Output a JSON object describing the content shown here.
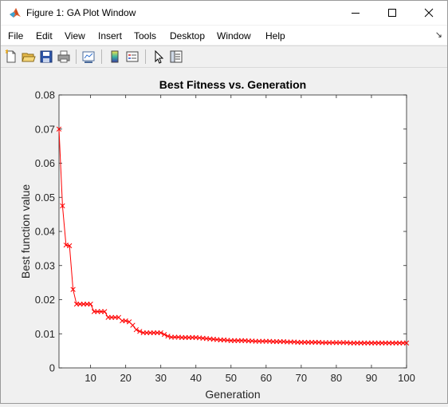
{
  "window": {
    "title": "Figure 1: GA Plot Window"
  },
  "menu": {
    "items": [
      "File",
      "Edit",
      "View",
      "Insert",
      "Tools",
      "Desktop",
      "Window",
      "Help"
    ]
  },
  "toolbar": {
    "buttons": [
      "new-figure-icon",
      "open-file-icon",
      "save-icon",
      "print-icon",
      "link-plot-icon",
      "insert-colorbar-icon",
      "insert-legend-icon",
      "edit-plot-arrow-icon",
      "property-inspector-icon"
    ]
  },
  "chart_data": {
    "type": "line",
    "title": "Best Fitness vs. Generation",
    "xlabel": "Generation",
    "ylabel": "Best function value",
    "xlim": [
      1,
      100
    ],
    "ylim": [
      0,
      0.08
    ],
    "xticks": [
      "10",
      "20",
      "30",
      "40",
      "50",
      "60",
      "70",
      "80",
      "90",
      "100"
    ],
    "yticks": [
      "0",
      "0.01",
      "0.02",
      "0.03",
      "0.04",
      "0.05",
      "0.06",
      "0.07",
      "0.08"
    ],
    "grid": false,
    "series": [
      {
        "color": "#ff0000",
        "marker": "x",
        "x": [
          1,
          2,
          3,
          4,
          5,
          6,
          7,
          8,
          9,
          10,
          11,
          12,
          13,
          14,
          15,
          16,
          17,
          18,
          19,
          20,
          21,
          22,
          23,
          24,
          25,
          26,
          27,
          28,
          29,
          30,
          31,
          32,
          33,
          34,
          35,
          36,
          37,
          38,
          39,
          40,
          41,
          42,
          43,
          44,
          45,
          46,
          47,
          48,
          49,
          50,
          51,
          52,
          53,
          54,
          55,
          56,
          57,
          58,
          59,
          60,
          61,
          62,
          63,
          64,
          65,
          66,
          67,
          68,
          69,
          70,
          71,
          72,
          73,
          74,
          75,
          76,
          77,
          78,
          79,
          80,
          81,
          82,
          83,
          84,
          85,
          86,
          87,
          88,
          89,
          90,
          91,
          92,
          93,
          94,
          95,
          96,
          97,
          98,
          99,
          100
        ],
        "values": [
          0.07,
          0.0475,
          0.036,
          0.0358,
          0.023,
          0.0187,
          0.0187,
          0.0187,
          0.0187,
          0.0187,
          0.0165,
          0.0165,
          0.0165,
          0.0165,
          0.0148,
          0.0148,
          0.0148,
          0.0148,
          0.0138,
          0.0138,
          0.0135,
          0.0125,
          0.0112,
          0.0107,
          0.0103,
          0.0103,
          0.0103,
          0.0103,
          0.0103,
          0.0103,
          0.0098,
          0.0093,
          0.009,
          0.009,
          0.009,
          0.0089,
          0.0089,
          0.0089,
          0.0089,
          0.0089,
          0.0088,
          0.0087,
          0.0086,
          0.0085,
          0.0084,
          0.0083,
          0.0082,
          0.0082,
          0.0081,
          0.008,
          0.008,
          0.008,
          0.008,
          0.008,
          0.0079,
          0.0079,
          0.0078,
          0.0078,
          0.0078,
          0.0078,
          0.0078,
          0.0077,
          0.0077,
          0.0077,
          0.0077,
          0.0076,
          0.0076,
          0.0076,
          0.0075,
          0.0075,
          0.0075,
          0.0075,
          0.0075,
          0.0075,
          0.0075,
          0.0074,
          0.0074,
          0.0074,
          0.0074,
          0.0074,
          0.0074,
          0.0074,
          0.0074,
          0.0073,
          0.0073,
          0.0073,
          0.0073,
          0.0073,
          0.0073,
          0.0073,
          0.0073,
          0.0073,
          0.0073,
          0.0073,
          0.0073,
          0.0073,
          0.0073,
          0.0073,
          0.0073,
          0.0073
        ]
      }
    ]
  }
}
